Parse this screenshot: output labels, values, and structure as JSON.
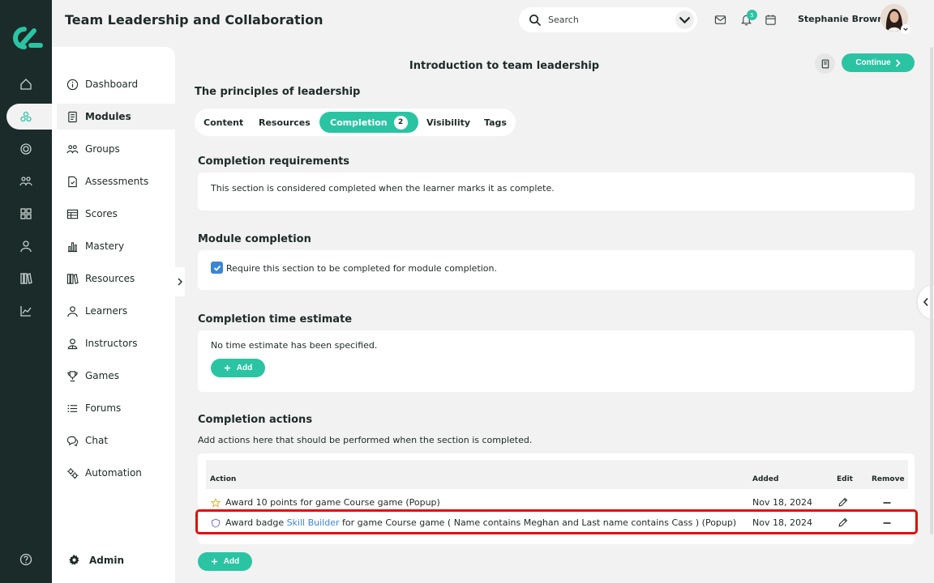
{
  "header": {
    "title": "Team Leadership and Collaboration",
    "search_placeholder": "Search",
    "notification_count": "5",
    "user_name": "Stephanie Brown"
  },
  "rail": {
    "icons": [
      "home-icon",
      "modules-icon",
      "target-icon",
      "groups-icon",
      "grid-icon",
      "user-icon",
      "library-icon",
      "chart-icon",
      "help-icon"
    ]
  },
  "sidebar": {
    "items": [
      {
        "label": "Dashboard",
        "icon": "info-icon"
      },
      {
        "label": "Modules",
        "icon": "book-icon"
      },
      {
        "label": "Groups",
        "icon": "groups-icon"
      },
      {
        "label": "Assessments",
        "icon": "document-icon"
      },
      {
        "label": "Scores",
        "icon": "table-icon"
      },
      {
        "label": "Mastery",
        "icon": "bar-chart-icon"
      },
      {
        "label": "Resources",
        "icon": "library-icon"
      },
      {
        "label": "Learners",
        "icon": "user-icon"
      },
      {
        "label": "Instructors",
        "icon": "instructor-icon"
      },
      {
        "label": "Games",
        "icon": "trophy-icon"
      },
      {
        "label": "Forums",
        "icon": "list-icon"
      },
      {
        "label": "Chat",
        "icon": "chat-icon"
      },
      {
        "label": "Automation",
        "icon": "cogs-icon"
      }
    ],
    "admin_label": "Admin"
  },
  "main": {
    "section_title": "Introduction to team leadership",
    "continue_label": "Continue",
    "principles_title": "The principles of leadership",
    "tabs": [
      {
        "label": "Content"
      },
      {
        "label": "Resources"
      },
      {
        "label": "Completion",
        "count": "2"
      },
      {
        "label": "Visibility"
      },
      {
        "label": "Tags"
      }
    ],
    "requirements": {
      "title": "Completion requirements",
      "text": "This section is considered completed when the learner marks it as complete."
    },
    "module_completion": {
      "title": "Module completion",
      "checkbox_label": "Require this section to be completed for module completion."
    },
    "time_estimate": {
      "title": "Completion time estimate",
      "text": "No time estimate has been specified.",
      "add_label": "Add"
    },
    "actions": {
      "title": "Completion actions",
      "description": "Add actions here that should be performed when the section is completed.",
      "columns": {
        "action": "Action",
        "added": "Added",
        "edit": "Edit",
        "remove": "Remove"
      },
      "rows": [
        {
          "pre": "Award 10 points for game Course game (Popup)",
          "link": "",
          "post": "",
          "added": "Nov 18, 2024",
          "icon": "star-icon"
        },
        {
          "pre": "Award badge ",
          "link": "Skill Builder",
          "post": " for game Course game ( Name contains Meghan and Last name contains Cass ) (Popup)",
          "added": "Nov 18, 2024",
          "icon": "shield-icon"
        }
      ],
      "add_label": "Add"
    }
  },
  "colors": {
    "accent": "#2ac4a3",
    "rail": "#1a2b2a",
    "highlight": "#e01010",
    "link": "#3a86d6"
  }
}
